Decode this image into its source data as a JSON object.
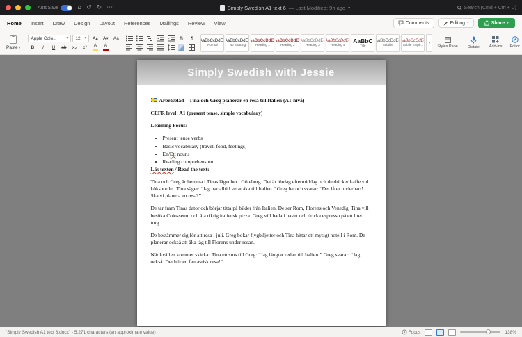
{
  "theme": {
    "titlebar_bg": "#1d1d1f",
    "ribbon_bg": "#f8f7f6",
    "accent_blue": "#2b7cd3",
    "share_green": "#2f9e4f",
    "autosave_blue": "#3a6fd8",
    "doc_background": "#7f7f7f",
    "squiggle_red": "#e0321f",
    "heading_style_red": "#a63d3d"
  },
  "icons": {
    "chevron": "▾",
    "home": "⌂",
    "undo": "↺",
    "redo": "↻",
    "more": "⋯",
    "sort": "⇅",
    "pilcrow": "¶"
  },
  "titlebar": {
    "autosave": "AutoSave",
    "title": "Simply Swedish A1 text 6",
    "modified": "— Last Modified: 9h ago",
    "search": "Search (Cmd + Ctrl + U)"
  },
  "tabs": {
    "home": "Home",
    "insert": "Insert",
    "draw": "Draw",
    "design": "Design",
    "layout": "Layout",
    "references": "References",
    "mailings": "Mailings",
    "review": "Review",
    "view": "View",
    "comments": "Comments",
    "editing": "Editing",
    "share": "Share"
  },
  "toolbar": {
    "paste": "Paste",
    "font_name": "Apple Colo...",
    "font_size": "12",
    "bold": "B",
    "italic": "I",
    "underline": "U",
    "strike": "ab",
    "subscript": "x₂",
    "superscript": "x²",
    "grow_font": "A▴",
    "shrink_font": "A▾",
    "change_case": "Aa",
    "highlight": "A",
    "font_color": "A",
    "styles_pane": "Styles Pane",
    "dictate": "Dictate",
    "addins": "Add-ins",
    "editor": "Editor"
  },
  "styles": {
    "s0": {
      "sample": "AaBbCcDdEe",
      "label": "Normal"
    },
    "s1": {
      "sample": "AaBbCcDdEe",
      "label": "No Spacing"
    },
    "s2": {
      "sample": "AaBbCcDdEe",
      "label": "Heading 1"
    },
    "s3": {
      "sample": "AaBbCcDdEe",
      "label": "Heading 2"
    },
    "s4": {
      "sample": "AaBbCcDdEe",
      "label": "Heading 3"
    },
    "s5": {
      "sample": "AaBbCcDdEe",
      "label": "Heading 4"
    },
    "s6": {
      "sample": "AaBbC",
      "label": "Title"
    },
    "s7": {
      "sample": "AaBbCcDdEe",
      "label": "Subtitle"
    },
    "s8": {
      "sample": "AaBbCcDdEe",
      "label": "Subtle Emph..."
    }
  },
  "document": {
    "banner": "Simply Swedish with Jessie",
    "heading": "Arbetsblad – Tina och Greg planerar en resa till Italien (A1-nivå)",
    "cefr_line": "CEFR level: A1 (present tense, simple vocabulary)",
    "focus_heading": "Learning Focus:",
    "bullet1": "Present tense verbs",
    "bullet2": "Basic vocabulary (travel, food, feelings)",
    "bullet3_pre": "En/",
    "bullet3_flagged": "Ett",
    "bullet3_post": " nouns",
    "bullet4": "Reading comprehension",
    "read_flagged": "Läs texten",
    "read_rest": " / Read the text:",
    "p1": "Tina och Greg är hemma i Tinas lägenhet i Göteborg. Det är lördag eftermiddag och de dricker kaffe vid köksbordet. Tina säger: “Jag har alltid velat åka till Italien.” Greg ler och svarar: “Det låter underbart! Ska vi planera en resa?”",
    "p2": "De tar fram Tinas dator och börjar titta på bilder från Italien. De ser Rom, Florens och Venedig. Tina vill besöka Colosseum och äta riktig italiensk pizza. Greg vill bada i havet och dricka espresso på ett litet torg.",
    "p3": "De bestämmer sig för att resa i juli. Greg bokar flygbiljetter och Tina hittar ett mysigt hotell i Rom. De planerar också att åka tåg till Florens under resan.",
    "p4": "När kvällen kommer skickar Tina ett sms till Greg: “Jag längtar redan till Italien!” Greg svarar: “Jag också. Det blir en fantastisk resa!”"
  },
  "statusbar": {
    "info": "\"Simply Swedish A1 text 6.docx\" - 5,271 characters (an approximate value)",
    "focus": "Focus",
    "zoom": "138%"
  }
}
